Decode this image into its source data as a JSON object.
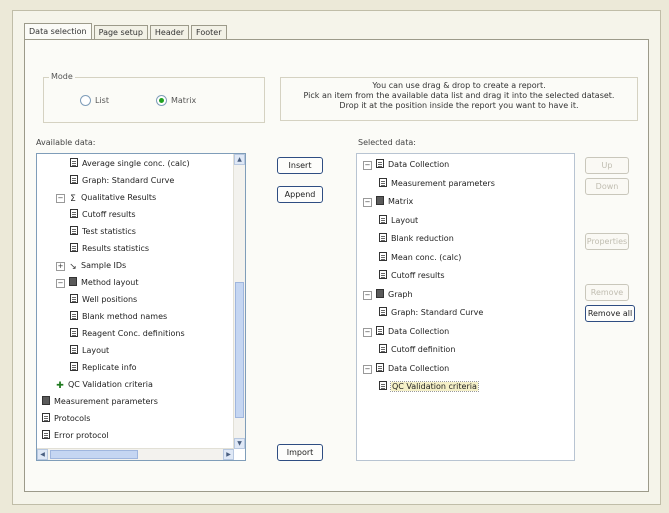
{
  "tabs": [
    "Data selection",
    "Page setup",
    "Header",
    "Footer"
  ],
  "mode": {
    "legend": "Mode",
    "options": [
      {
        "label": "List",
        "selected": false
      },
      {
        "label": "Matrix",
        "selected": true
      }
    ]
  },
  "info_lines": [
    "You can use drag & drop to create a report.",
    "Pick an item from the available data list and drag it into the selected dataset.",
    "Drop it at the position inside the report you want to have it."
  ],
  "available": {
    "label": "Available data:",
    "items": [
      {
        "text": "Average single conc. (calc)",
        "icon": "doc-icon",
        "indent": 2
      },
      {
        "text": "Graph: Standard Curve",
        "icon": "doc-icon",
        "indent": 2
      },
      {
        "text": "Qualitative Results",
        "icon": "sigma-icon",
        "indent": 1,
        "expander": "-"
      },
      {
        "text": "Cutoff results",
        "icon": "doc-icon",
        "indent": 2
      },
      {
        "text": "Test statistics",
        "icon": "doc-icon",
        "indent": 2
      },
      {
        "text": "Results statistics",
        "icon": "doc-icon",
        "indent": 2
      },
      {
        "text": "Sample IDs",
        "icon": "line-icon",
        "indent": 1,
        "expander": "+"
      },
      {
        "text": "Method layout",
        "icon": "folder-icon",
        "indent": 1,
        "expander": "-"
      },
      {
        "text": "Well positions",
        "icon": "doc-icon",
        "indent": 2
      },
      {
        "text": "Blank method names",
        "icon": "doc-icon",
        "indent": 2
      },
      {
        "text": "Reagent Conc. definitions",
        "icon": "doc-icon",
        "indent": 2
      },
      {
        "text": "Layout",
        "icon": "doc-icon",
        "indent": 2
      },
      {
        "text": "Replicate info",
        "icon": "doc-icon",
        "indent": 2
      },
      {
        "text": "QC Validation criteria",
        "icon": "plus-icon",
        "indent": 1
      },
      {
        "text": "Measurement parameters",
        "icon": "folder-icon",
        "indent": 0
      },
      {
        "text": "Protocols",
        "icon": "doc-icon",
        "indent": 0
      },
      {
        "text": "Error protocol",
        "icon": "doc-icon",
        "indent": 0
      }
    ]
  },
  "selected": {
    "label": "Selected data:",
    "items": [
      {
        "text": "Data Collection",
        "icon": "doc-icon",
        "indent": 0,
        "expander": "-"
      },
      {
        "text": "Measurement parameters",
        "icon": "doc-icon",
        "indent": 1
      },
      {
        "text": "Matrix",
        "icon": "folder-icon",
        "indent": 0,
        "expander": "-"
      },
      {
        "text": "Layout",
        "icon": "doc-icon",
        "indent": 1
      },
      {
        "text": "Blank reduction",
        "icon": "doc-icon",
        "indent": 1
      },
      {
        "text": "Mean conc. (calc)",
        "icon": "doc-icon",
        "indent": 1
      },
      {
        "text": "Cutoff results",
        "icon": "doc-icon",
        "indent": 1
      },
      {
        "text": "Graph",
        "icon": "folder-icon",
        "indent": 0,
        "expander": "-"
      },
      {
        "text": "Graph: Standard Curve",
        "icon": "doc-icon",
        "indent": 1
      },
      {
        "text": "Data Collection",
        "icon": "doc-icon",
        "indent": 0,
        "expander": "-"
      },
      {
        "text": "Cutoff definition",
        "icon": "doc-icon",
        "indent": 1
      },
      {
        "text": "Data Collection",
        "icon": "doc-icon",
        "indent": 0,
        "expander": "-"
      },
      {
        "text": "QC Validation criteria",
        "icon": "doc-icon",
        "indent": 1,
        "selected": true
      }
    ]
  },
  "buttons": {
    "insert": "Insert",
    "append": "Append",
    "import": "Import",
    "up": "Up",
    "down": "Down",
    "properties": "Properties",
    "remove": "Remove",
    "remove_all": "Remove all"
  }
}
